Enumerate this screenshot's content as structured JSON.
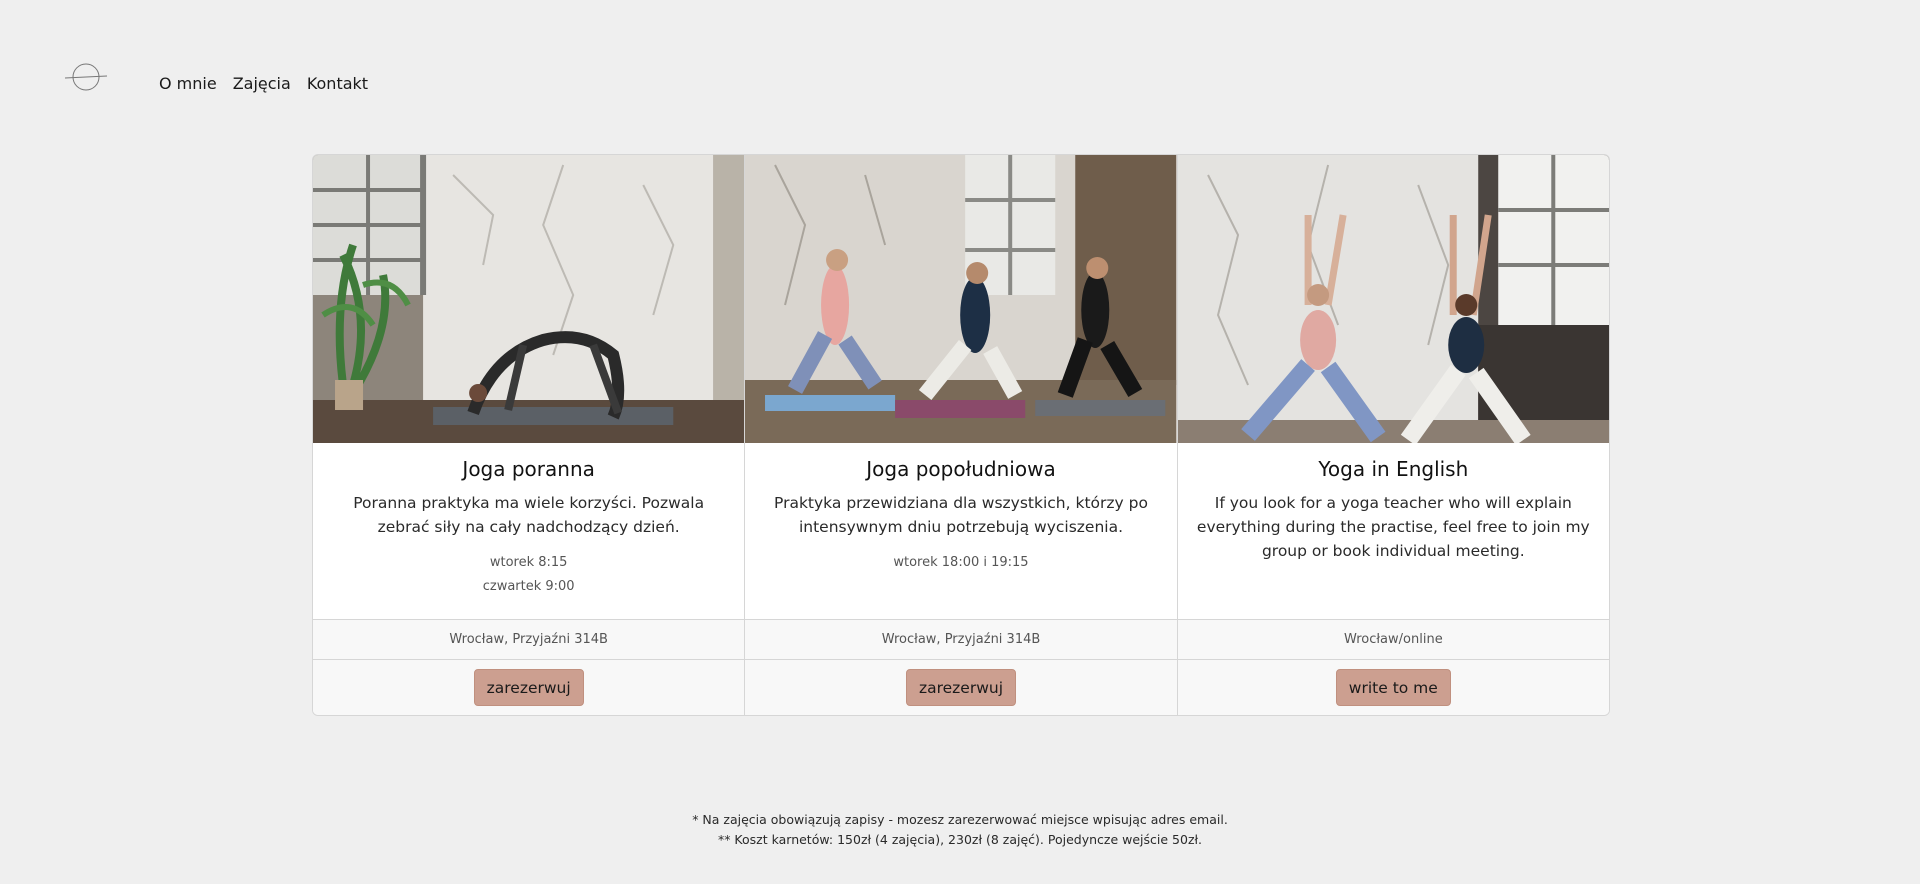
{
  "nav": {
    "logo_icon": "circle-line-logo",
    "links": [
      "O mnie",
      "Zajęcia",
      "Kontakt"
    ]
  },
  "cards": [
    {
      "title": "Joga poranna",
      "description": "Poranna praktyka ma wiele korzyści. Pozwala zebrać siły na cały nadchodzący dzień.",
      "schedule": [
        "wtorek 8:15",
        "czwartek 9:00"
      ],
      "location": "Wrocław, Przyjaźni 314B",
      "button": "zarezerwuj"
    },
    {
      "title": "Joga popołudniowa",
      "description": "Praktyka przewidziana dla wszystkich, którzy po intensywnym dniu potrzebują wyciszenia.",
      "schedule": [
        "wtorek 18:00 i 19:15",
        ""
      ],
      "location": "Wrocław, Przyjaźni 314B",
      "button": "zarezerwuj"
    },
    {
      "title": "Yoga in English",
      "description": "If you look for a yoga teacher who will explain everything during the practise, feel free to join my group or book individual meeting.",
      "schedule": [
        "",
        ""
      ],
      "location": "Wrocław/online",
      "button": "write to me"
    }
  ],
  "footnotes": [
    "* Na zajęcia obowiązują zapisy - mozesz zarezerwować miejsce wpisując adres email.",
    "** Koszt karnetów: 150zł (4 zajęcia), 230zł (8 zajęć). Pojedyncze wejście 50zł."
  ],
  "colors": {
    "background": "#efefef",
    "button": "#cc9f90",
    "card_footer": "#f8f8f8"
  }
}
